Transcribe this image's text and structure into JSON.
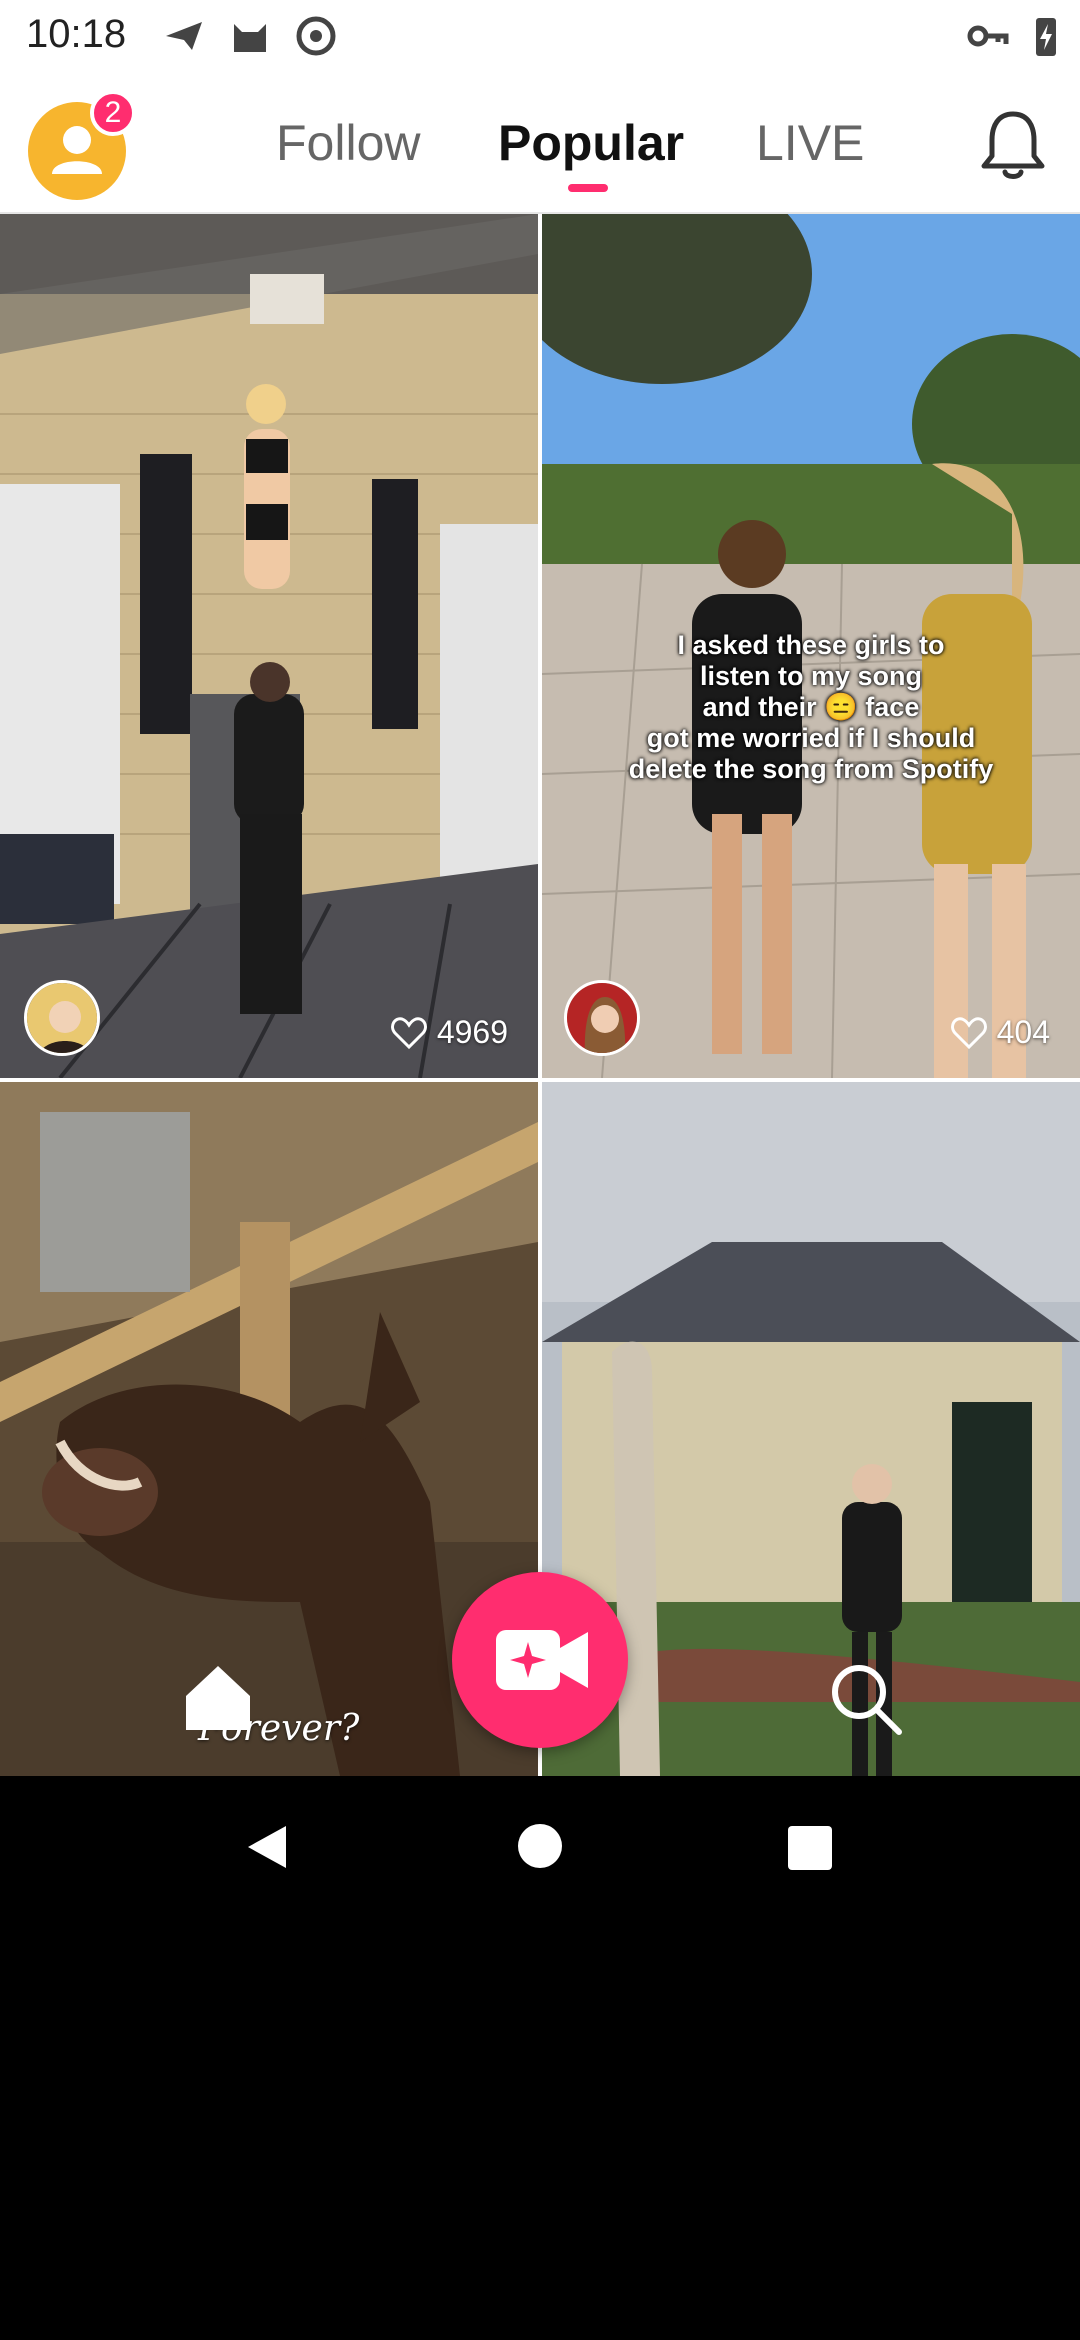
{
  "status_bar": {
    "time": "10:18",
    "left_icons": [
      "send-icon",
      "cat-icon",
      "at-sign-icon"
    ],
    "right_icons": [
      "vpn-key-icon",
      "battery-charging-icon"
    ]
  },
  "header": {
    "notification_count": "2",
    "tabs": [
      {
        "label": "Follow",
        "active": false
      },
      {
        "label": "Popular",
        "active": true
      },
      {
        "label": "LIVE",
        "active": false
      }
    ],
    "accent_color": "#ff2d6f"
  },
  "feed": {
    "items": [
      {
        "likes": "4969",
        "caption": ""
      },
      {
        "likes": "404",
        "caption_lines": [
          "I asked these girls to",
          "listen to my song",
          "and their 😑 face",
          "got me worried if I should",
          "delete the song from Spotify"
        ]
      },
      {
        "caption": "Forever?"
      },
      {
        "caption": ""
      }
    ]
  },
  "bottom_nav": {
    "items": [
      "home-icon",
      "record-video-icon",
      "search-icon"
    ]
  },
  "system_nav": [
    "back-icon",
    "home-circle-icon",
    "recents-icon"
  ]
}
